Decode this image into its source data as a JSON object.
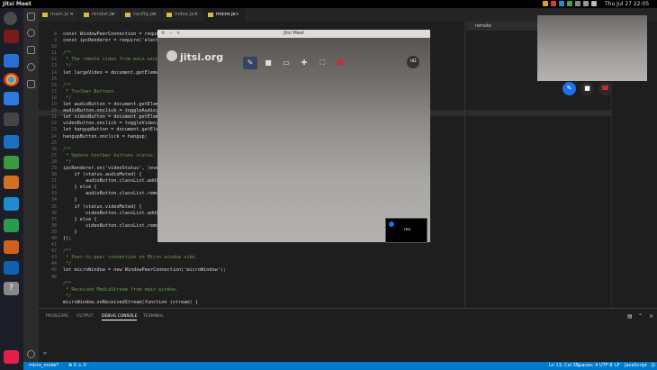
{
  "topbar": {
    "app_name": "Jitsi Meet",
    "clock": "Thu Jul 27 22:05"
  },
  "tabs": [
    {
      "label": "main.js",
      "close": "×"
    },
    {
      "label": "render.js",
      "close": "×"
    },
    {
      "label": "config.js",
      "close": "×"
    },
    {
      "label": "index.js",
      "close": "×"
    },
    {
      "label": "micro.js",
      "close": "×"
    }
  ],
  "remote_panel": {
    "label": "remote"
  },
  "editor": {
    "line_numbers": [
      "8",
      "9",
      "10",
      "11",
      "12",
      "13",
      "14",
      "15",
      "16",
      "17",
      "18",
      "19",
      "20",
      "21",
      "22",
      "23",
      "24",
      "25",
      "26",
      "27",
      "28",
      "29",
      "30",
      "31",
      "32",
      "33",
      "34",
      "35",
      "36",
      "37",
      "38",
      "39",
      "40",
      "41",
      "42",
      "43",
      "44",
      "45",
      "46"
    ],
    "lines": [
      "const WindowPeerConnection = require('electron-peer-connection').WindowPeerConnection;",
      "const ipcRenderer = require('electron').ipcRenderer;",
      "",
      "/**",
      " * The remote video from main window.",
      " */",
      "let largeVideo = document.getElementById('largeVideo');",
      "",
      "/**",
      " * Toolbar Buttons.",
      " */",
      "let audioButton = document.getElementById('audio');",
      "audioButton.onclick = toggleAudio;",
      "let videoButton = document.getElementById('video');",
      "videoButton.onclick = toggleVideo;",
      "let hangupButton = document.getElementById('hangup');",
      "hangupButton.onclick = hangup;",
      "",
      "/**",
      " * Update toolbar buttons status.",
      " */",
      "ipcRenderer.on('videoStatus', (event, status) => {",
      "    if (status.audioMuted) {",
      "        audioButton.classList.add('muted');",
      "    } else {",
      "        audioButton.classList.remove('muted');",
      "    }",
      "    if (status.videoMuted) {",
      "        videoButton.classList.add('muted');",
      "    } else {",
      "        videoButton.classList.remove('muted');",
      "    }",
      "});",
      "",
      "/**",
      " * Peer-to-peer connection on Micro window side.",
      " */",
      "let microWindow = new WindowPeerConnection('microWindow');",
      "",
      "/**",
      " * Received MediaStream from main window.",
      " */",
      "microWindow.onReceivedStream(function (stream) {"
    ]
  },
  "panel": {
    "tabs": [
      "PROBLEMS",
      "OUTPUT",
      "DEBUG CONSOLE",
      "TERMINAL"
    ],
    "prompt": ">"
  },
  "status": {
    "branch": "micro_mode*",
    "problems": "⊗ 0 ⚠ 0",
    "position": "Ln 13, Col 35",
    "spaces": "Spaces: 4",
    "encoding": "UTF-8",
    "eol": "LF",
    "language": "JavaScript"
  },
  "jitsi": {
    "title": "Jitsi Meet",
    "logo": "jitsi.org",
    "hd": "HD",
    "self_label": "me",
    "toolbar_icons": [
      "microphone-muted-icon",
      "camera-icon",
      "desktop-share-icon",
      "add-participant-icon",
      "fullscreen-icon",
      "hangup-icon"
    ]
  },
  "micro_controls": [
    "microphone-muted-icon",
    "camera-icon",
    "hangup-icon"
  ]
}
